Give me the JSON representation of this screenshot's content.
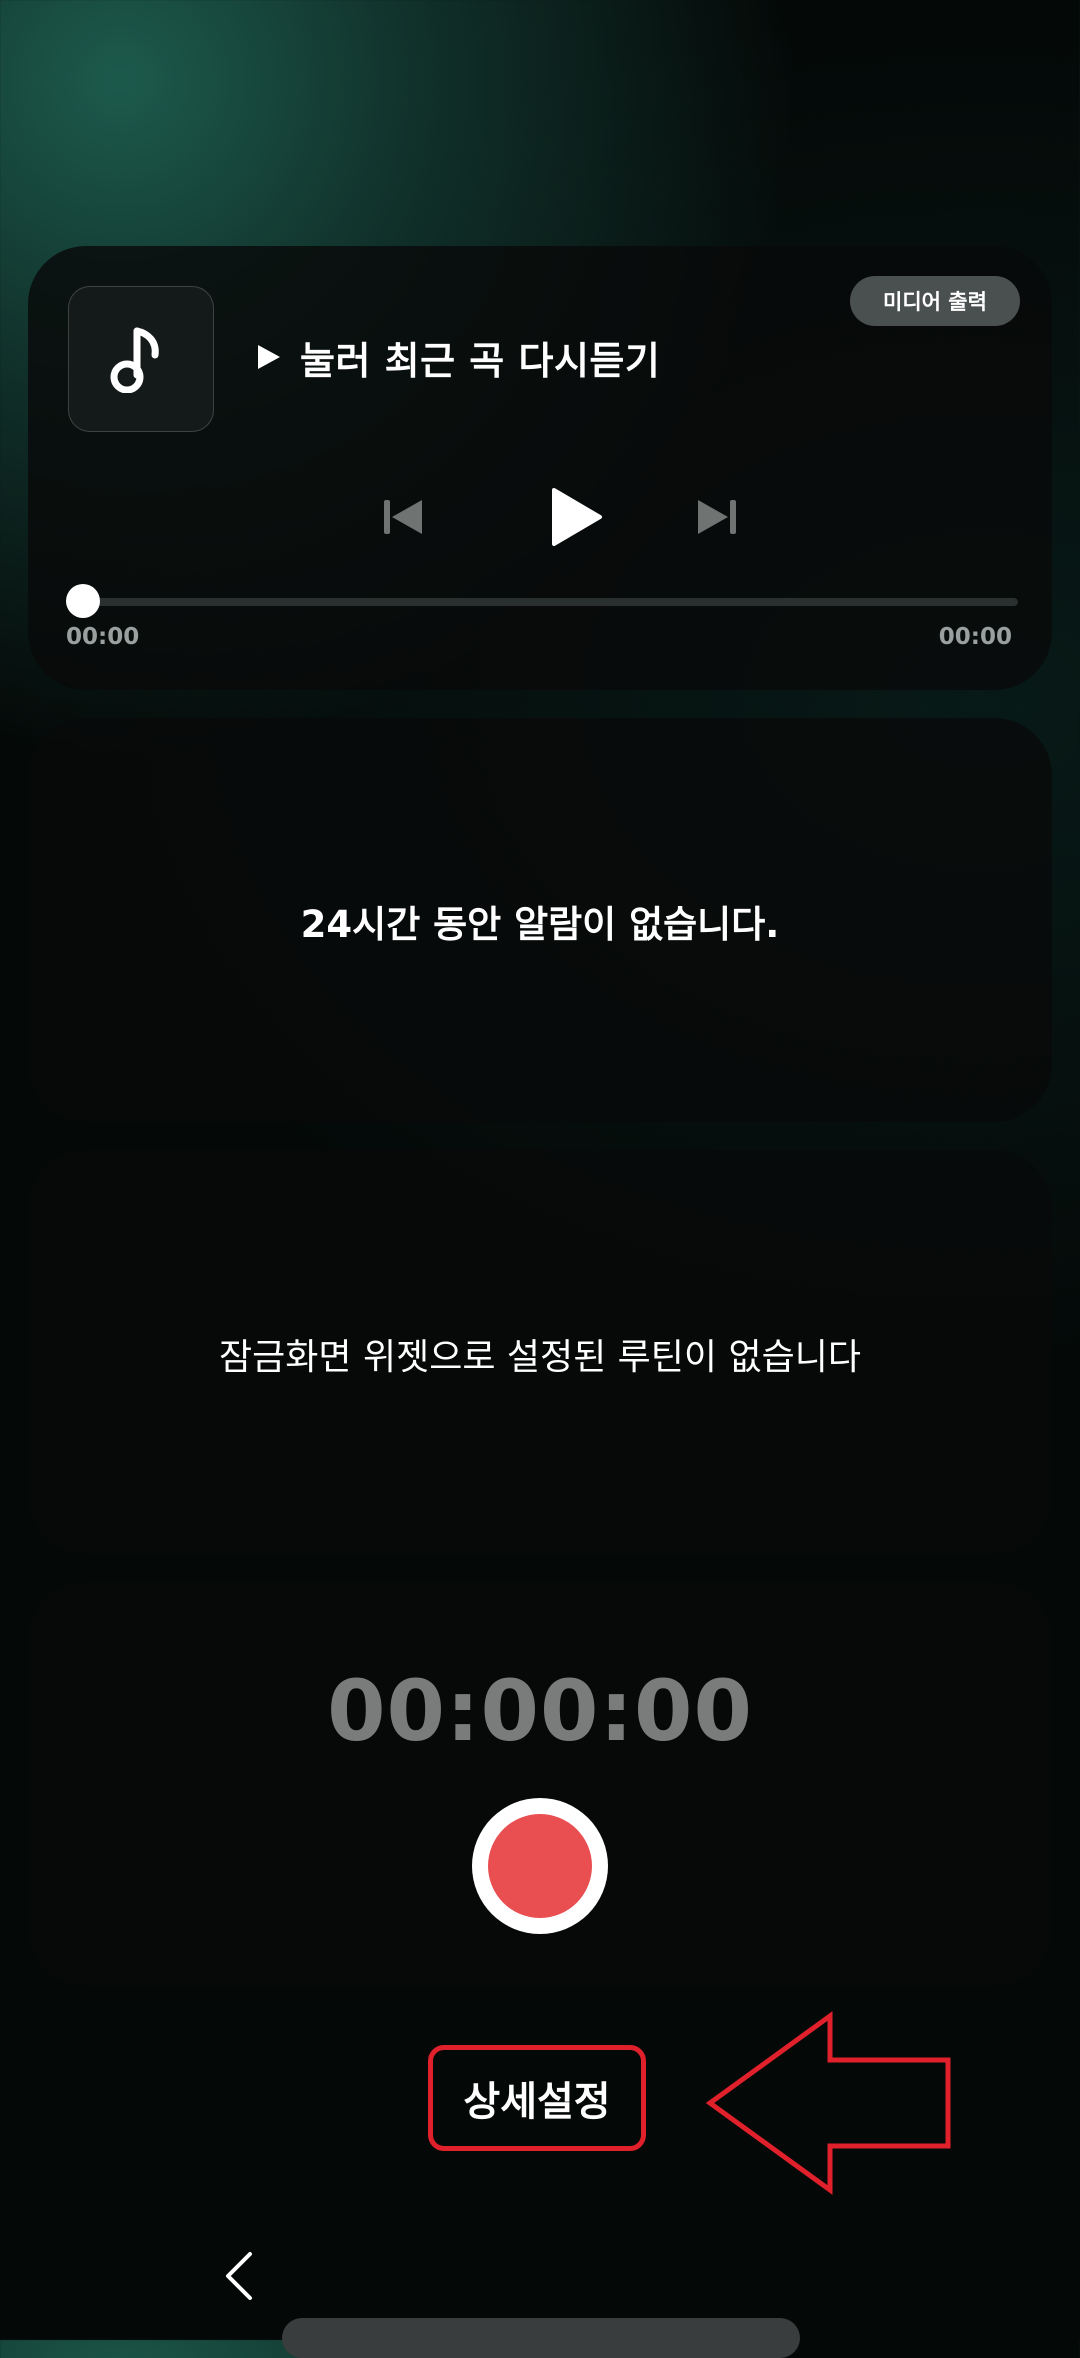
{
  "media": {
    "track_title": "눌러 최근 곡 다시듣기",
    "output_button_label": "미디어 출력",
    "elapsed": "00:00",
    "total": "00:00",
    "progress_fraction": 0
  },
  "alarm": {
    "message": "24시간 동안 알람이 없습니다."
  },
  "routine": {
    "message": "잠금화면 위젯으로 설정된 루틴이 없습니다"
  },
  "recorder": {
    "time": "00:00:00",
    "record_color": "#e94e51"
  },
  "settings": {
    "button_label": "상세설정",
    "highlight_color": "#e0212b"
  },
  "icons": {
    "album": "music-note-icon",
    "prev": "skip-previous-icon",
    "play": "play-icon",
    "next": "skip-next-icon",
    "back": "back-chevron-icon"
  }
}
